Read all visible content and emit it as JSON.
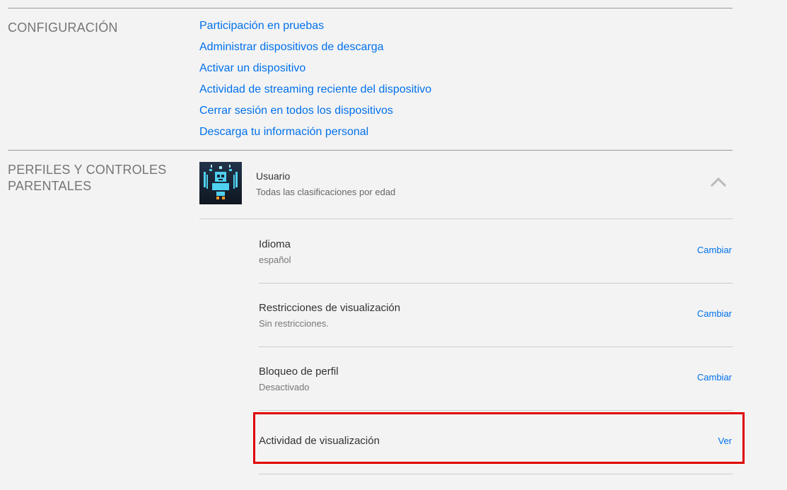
{
  "settings": {
    "title": "CONFIGURACIÓN",
    "links": [
      "Participación en pruebas",
      "Administrar dispositivos de descarga",
      "Activar un dispositivo",
      "Actividad de streaming reciente del dispositivo",
      "Cerrar sesión en todos los dispositivos",
      "Descarga tu información personal"
    ]
  },
  "profiles": {
    "title": "PERFILES Y CONTROLES PARENTALES",
    "profile": {
      "name": "Usuario",
      "rating": "Todas las clasificaciones por edad"
    },
    "rows": [
      {
        "label": "Idioma",
        "value": "español",
        "action": "Cambiar"
      },
      {
        "label": "Restricciones de visualización",
        "value": "Sin restricciones.",
        "action": "Cambiar"
      },
      {
        "label": "Bloqueo de perfil",
        "value": "Desactivado",
        "action": "Cambiar"
      },
      {
        "label": "Actividad de visualización",
        "value": "",
        "action": "Ver"
      }
    ]
  },
  "colors": {
    "link": "#0071eb",
    "highlight": "#e00000",
    "background": "#f3f3f3"
  },
  "icons": {
    "avatar": "robot-avatar-icon",
    "collapse": "chevron-up-icon"
  }
}
